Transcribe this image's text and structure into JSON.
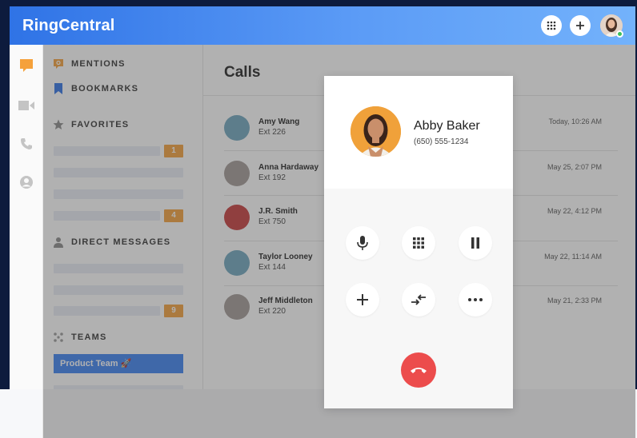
{
  "app": {
    "logo": "RingCentral"
  },
  "topbar": {
    "dialpad_icon": "dialpad-icon",
    "add_icon": "plus-icon",
    "avatar": "user-avatar"
  },
  "rail": {
    "items": [
      "message-icon",
      "video-icon",
      "phone-icon",
      "contacts-icon"
    ]
  },
  "sidebar": {
    "mentions": "MENTIONS",
    "bookmarks": "BOOKMARKS",
    "favorites": "FAVORITES",
    "favorites_badges": [
      "1",
      "4"
    ],
    "direct_messages": "DIRECT MESSAGES",
    "dm_badge": "9",
    "teams": "TEAMS",
    "team_selected": "Product Team 🚀"
  },
  "main": {
    "title": "Calls",
    "calls": [
      {
        "name": "Amy Wang",
        "ext": "Ext 226",
        "time": "Today, 10:26 AM",
        "color": "#6fa6bd"
      },
      {
        "name": "Anna Hardaway",
        "ext": "Ext 192",
        "time": "May 25, 2:07 PM",
        "color": "#a39a96"
      },
      {
        "name": "J.R. Smith",
        "ext": "Ext 750",
        "time": "May 22, 4:12 PM",
        "color": "#c63c3c"
      },
      {
        "name": "Taylor Looney",
        "ext": "Ext 144",
        "time": "May 22, 11:14 AM",
        "color": "#6fa6bd"
      },
      {
        "name": "Jeff Middleton",
        "ext": "Ext 220",
        "time": "May 21, 2:33 PM",
        "color": "#a39a96"
      }
    ]
  },
  "call_card": {
    "caller_name": "Abby Baker",
    "caller_phone": "(650) 555-1234",
    "controls": [
      "mute-icon",
      "keypad-icon",
      "hold-icon",
      "add-call-icon",
      "transfer-icon",
      "more-icon"
    ],
    "hangup": "hangup-icon"
  },
  "colors": {
    "brand_blue": "#2f73e6",
    "accent_orange": "#f5a13b",
    "hangup_red": "#ec4c4c"
  }
}
